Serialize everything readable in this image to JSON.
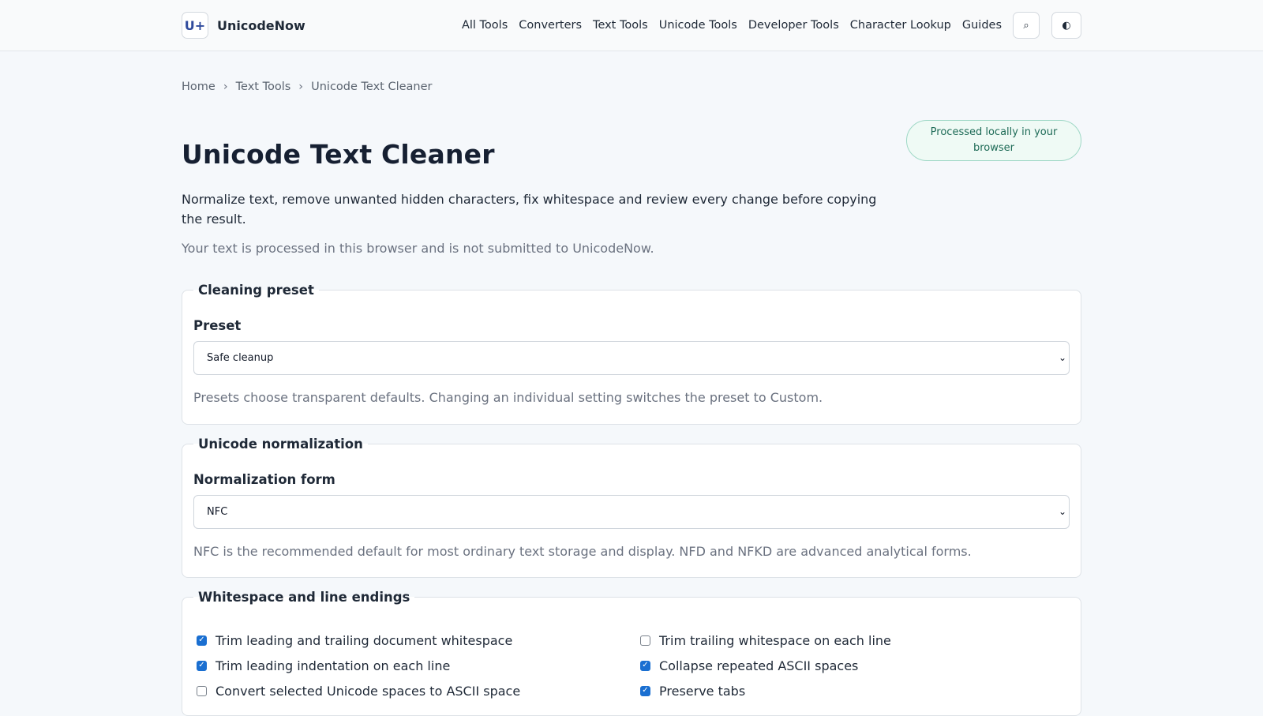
{
  "header": {
    "logo_text": "U+",
    "brand": "UnicodeNow",
    "nav": [
      "All Tools",
      "Converters",
      "Text Tools",
      "Unicode Tools",
      "Developer Tools",
      "Character Lookup",
      "Guides"
    ],
    "search_icon": "search-icon",
    "search_glyph": "⌕",
    "theme_icon": "contrast-icon",
    "theme_glyph": "◐"
  },
  "breadcrumb": {
    "items": [
      "Home",
      "Text Tools",
      "Unicode Text Cleaner"
    ],
    "separator": "›"
  },
  "page": {
    "title": "Unicode Text Cleaner",
    "badge": "Processed locally in your browser",
    "intro": "Normalize text, remove unwanted hidden characters, fix whitespace and review every change before copying the result.",
    "privacy_note": "Your text is processed in this browser and is not submitted to UnicodeNow."
  },
  "preset_section": {
    "legend": "Cleaning preset",
    "label": "Preset",
    "selected": "Safe cleanup",
    "help": "Presets choose transparent defaults. Changing an individual setting switches the preset to Custom."
  },
  "normalization_section": {
    "legend": "Unicode normalization",
    "label": "Normalization form",
    "selected": "NFC",
    "help": "NFC is the recommended default for most ordinary text storage and display. NFD and NFKD are advanced analytical forms."
  },
  "whitespace_section": {
    "legend": "Whitespace and line endings",
    "options": [
      {
        "label": "Trim leading and trailing document whitespace",
        "checked": true
      },
      {
        "label": "Trim trailing whitespace on each line",
        "checked": false
      },
      {
        "label": "Trim leading indentation on each line",
        "checked": true
      },
      {
        "label": "Collapse repeated ASCII spaces",
        "checked": true
      },
      {
        "label": "Convert selected Unicode spaces to ASCII space",
        "checked": false
      },
      {
        "label": "Preserve tabs",
        "checked": true
      }
    ]
  },
  "colors": {
    "accent": "#1a6fd1",
    "badge_border": "#9fd8c6",
    "badge_bg": "#effaf5",
    "badge_text": "#1e6b57",
    "page_bg": "#f5f8fb"
  }
}
